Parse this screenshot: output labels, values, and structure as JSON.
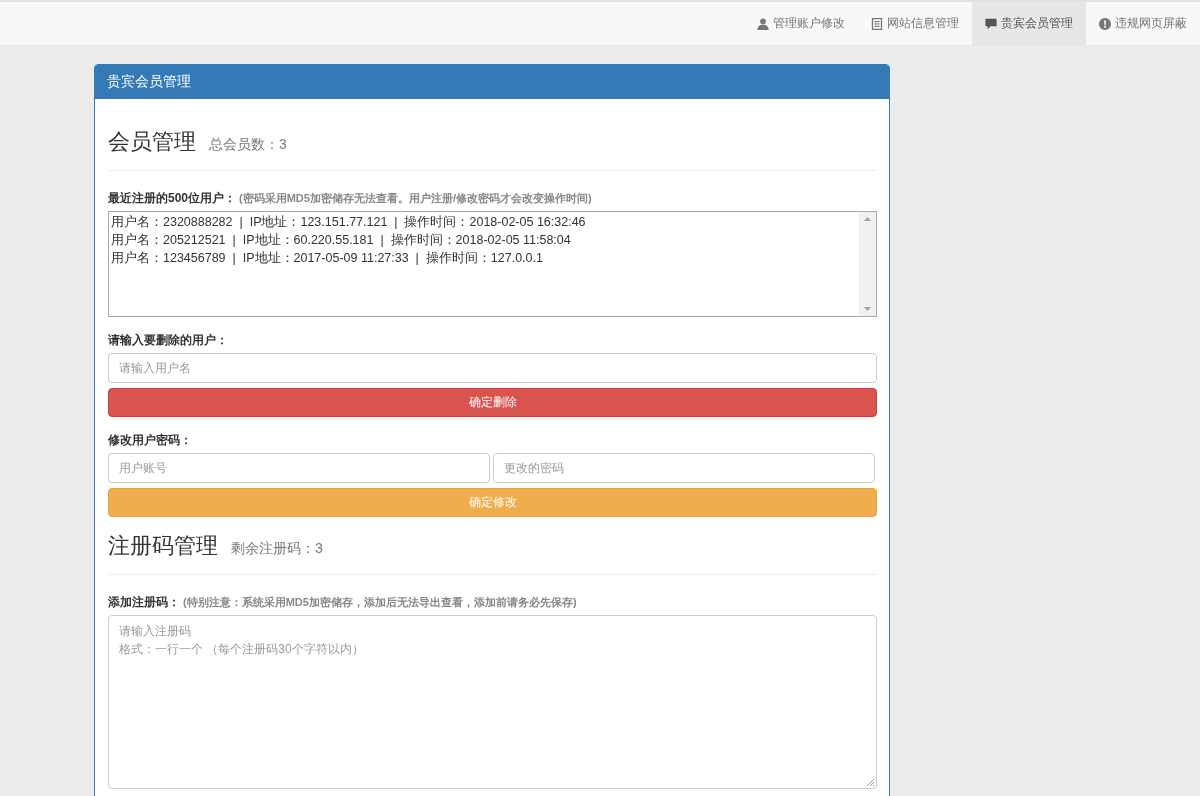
{
  "navbar": {
    "items": [
      {
        "label": "管理账户修改",
        "selected": false
      },
      {
        "label": "网站信息管理",
        "selected": false
      },
      {
        "label": "贵宾会员管理",
        "selected": true
      },
      {
        "label": "违规网页屏蔽",
        "selected": false
      }
    ]
  },
  "panel": {
    "title": "贵宾会员管理",
    "members": {
      "heading": "会员管理",
      "count": "总会员数：3",
      "recent_users": {
        "label": "最近注册的500位用户：",
        "note": "(密码采用MD5加密储存无法查看。用户注册/修改密码才会改变操作时间)",
        "lines": [
          "用户名：2320888282  |  IP地址：123.151.77.121  |  操作时间：2018-02-05 16:32:46",
          "用户名：205212521  |  IP地址：60.220.55.181  |  操作时间：2018-02-05 11:58:04",
          "用户名：123456789  |  IP地址：2017-05-09 11:27:33  |  操作时间：127.0.0.1"
        ]
      },
      "delete_user": {
        "label": "请输入要删除的用户：",
        "placeholder": "请输入用户名",
        "button": "确定删除"
      },
      "change_password": {
        "label": "修改用户密码：",
        "account_placeholder": "用户账号",
        "password_placeholder": "更改的密码",
        "button": "确定修改"
      }
    },
    "codes": {
      "heading": "注册码管理",
      "count": "剩余注册码：3",
      "add": {
        "label": "添加注册码：",
        "note": "(特别注意：系统采用MD5加密储存，添加后无法导出查看，添加前请务必先保存)",
        "placeholder_lines": [
          "请输入注册码",
          "格式：一行一个 （每个注册码30个字符以内）"
        ]
      }
    }
  }
}
